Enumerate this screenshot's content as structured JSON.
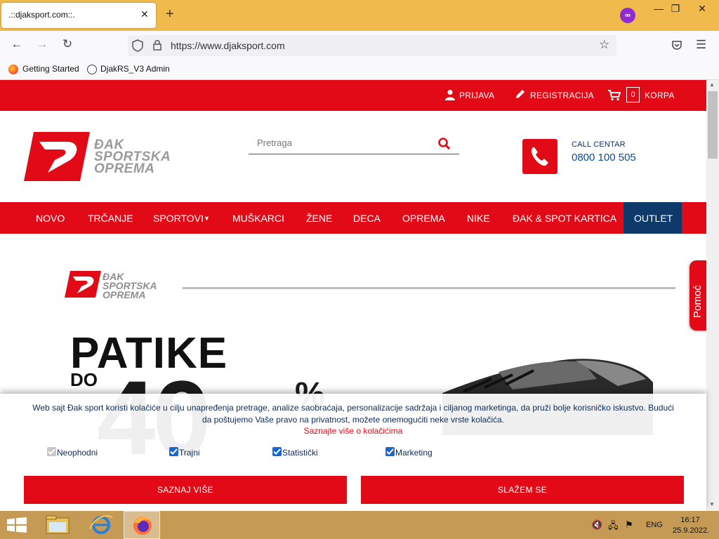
{
  "browser": {
    "tab_title": ".::djaksport.com::.",
    "url": "https://www.djaksport.com",
    "bookmarks": [
      "Getting Started",
      "DjakRS_V3 Admin"
    ]
  },
  "topbar": {
    "login": "PRIJAVA",
    "register": "REGISTRACIJA",
    "cart_count": "0",
    "cart": "KORPA"
  },
  "header": {
    "logo_line1": "ĐAK",
    "logo_line2": "SPORTSKA",
    "logo_line3": "OPREMA",
    "search_placeholder": "Pretraga",
    "call_center_label": "CALL CENTAR",
    "call_center_phone": "0800 100 505"
  },
  "nav": {
    "items": [
      "NOVO",
      "TRČANJE",
      "SPORTOVI",
      "MUŠKARCI",
      "ŽENE",
      "DECA",
      "OPREMA",
      "NIKE",
      "ĐAK & SPOT KARTICA",
      "OUTLET"
    ]
  },
  "hero": {
    "logo_line1": "ĐAK",
    "logo_line2": "SPORTSKA",
    "logo_line3": "OPREMA",
    "headline": "PATIKE",
    "do": "DO",
    "percent_number": "40",
    "percent_sign": "%"
  },
  "help_tab": "Pomoć",
  "cookie": {
    "text": "Web sajt Đak sport koristi kolačiće u cilju unapređenja pretrage, analize saobraćaja, personalizacije sadržaja i ciljanog marketinga, da pruži bolje korisničko iskustvo. Budući da poštujemo Vaše pravo na privatnost, možete onemogućiti neke vrste kolačića.",
    "link": "Saznajte više o kolačićima",
    "checkboxes": [
      {
        "label": "Neophodni",
        "checked": true,
        "disabled": true
      },
      {
        "label": "Trajni",
        "checked": true,
        "disabled": false
      },
      {
        "label": "Statistički",
        "checked": true,
        "disabled": false
      },
      {
        "label": "Marketing",
        "checked": true,
        "disabled": false
      }
    ],
    "btn_more": "SAZNAJ VIŠE",
    "btn_accept": "SLAŽEM SE"
  },
  "taskbar": {
    "lang": "ENG",
    "time": "16:17",
    "date": "25.9.2022."
  },
  "colors": {
    "brand_red": "#e30a17",
    "outlet_blue": "#0e3a6b",
    "titlebar": "#f0ba4d"
  }
}
